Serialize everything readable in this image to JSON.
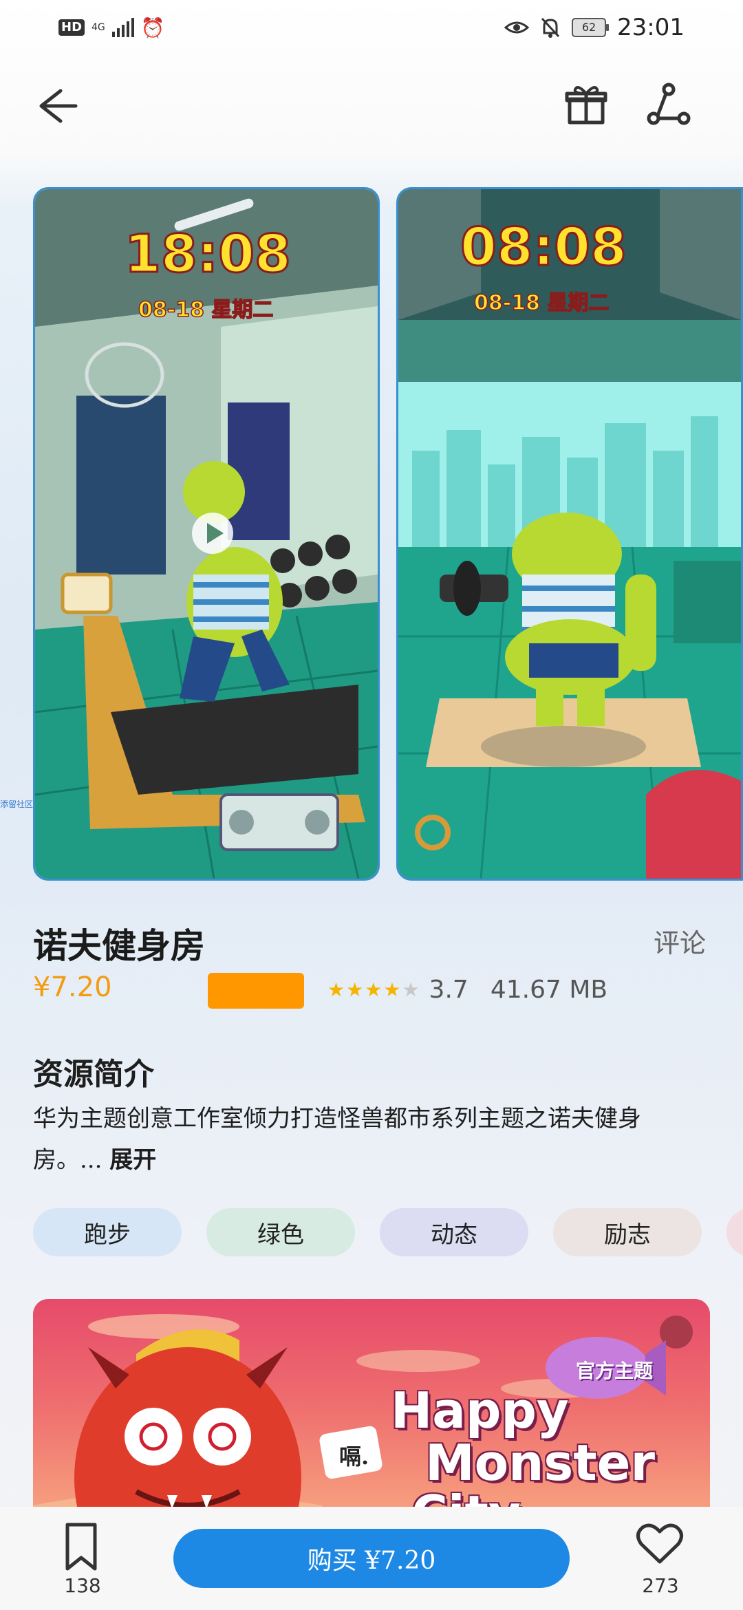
{
  "status_bar": {
    "hd": "HD",
    "network": "4G",
    "battery": "62",
    "time": "23:01"
  },
  "side_tag": "添留社区",
  "previews": {
    "first": {
      "clock": "18:08",
      "date": "08-18 星期二"
    },
    "second": {
      "clock": "08:08",
      "date": "08-18 星期二"
    }
  },
  "theme": {
    "title": "诺夫健身房",
    "comments_label": "评论",
    "price": "¥7.20",
    "rating": "3.7",
    "rating_stars": 3.7,
    "size": "41.67 MB"
  },
  "intro": {
    "heading": "资源简介",
    "text": "华为主题创意工作室倾力打造怪兽都市系列主题之诺夫健身房。...",
    "expand_label": "展开"
  },
  "tags": [
    "跑步",
    "绿色",
    "动态",
    "励志"
  ],
  "banner": {
    "line1": "Happy",
    "line2": "Monster",
    "line3": "City",
    "blimp_label": "官方主题",
    "speech": "嗝."
  },
  "bottom_bar": {
    "bookmark_count": "138",
    "buy_label": "购买 ¥7.20",
    "like_count": "273"
  },
  "colors": {
    "accent": "#1e88e5",
    "price": "#f39c12",
    "star": "#f5b400"
  }
}
